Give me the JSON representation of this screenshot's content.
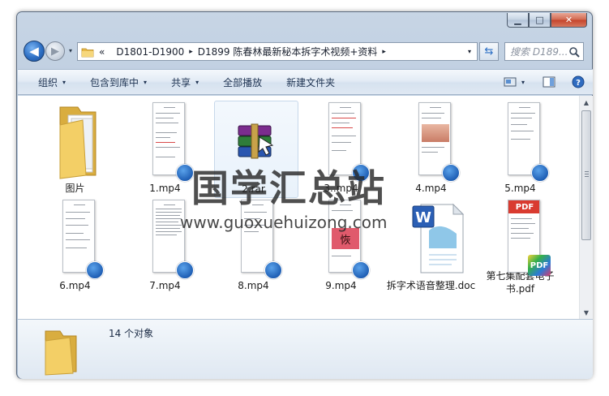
{
  "window": {
    "minimize_glyph": "▁",
    "maximize_glyph": "□",
    "close_glyph": "✕"
  },
  "nav": {
    "back_glyph": "◀",
    "forward_glyph": "▶",
    "dropdown_glyph": "▾",
    "overflow": "«",
    "breadcrumbs": [
      "D1801-D1900",
      "D1899 陈春林最新秘本拆字术视频+资料"
    ],
    "crumb_separator": "▸",
    "refresh_glyph": "⇆",
    "search_placeholder": "搜索 D189..."
  },
  "toolbar": {
    "organize": "组织",
    "include_in_library": "包含到库中",
    "share": "共享",
    "play_all": "全部播放",
    "new_folder": "新建文件夹",
    "arrow": "▾"
  },
  "files": [
    {
      "name": "图片",
      "type": "folder"
    },
    {
      "name": "1.mp4",
      "type": "video"
    },
    {
      "name": "2.rar",
      "type": "rar"
    },
    {
      "name": "3..mp4",
      "type": "video"
    },
    {
      "name": "4.mp4",
      "type": "video"
    },
    {
      "name": "5.mp4",
      "type": "video"
    },
    {
      "name": "6.mp4",
      "type": "video"
    },
    {
      "name": "7.mp4",
      "type": "video"
    },
    {
      "name": "8.mp4",
      "type": "video"
    },
    {
      "name": "9.mp4",
      "type": "video"
    },
    {
      "name": "拆字术语音整理.doc",
      "type": "doc"
    },
    {
      "name": "第七集配套电子书.pdf",
      "type": "pdf"
    }
  ],
  "status": {
    "count_text": "14 个对象"
  },
  "watermark": {
    "title": "国学汇总站",
    "url": "www.guoxuehuizong.com"
  },
  "icons": {
    "pdf_label": "PDF",
    "word_label": "W",
    "frame_char": "恢"
  },
  "colors": {
    "accent_blue": "#1f5fb5",
    "folder_yellow": "#f0c65a",
    "close_red": "#c4442b"
  }
}
